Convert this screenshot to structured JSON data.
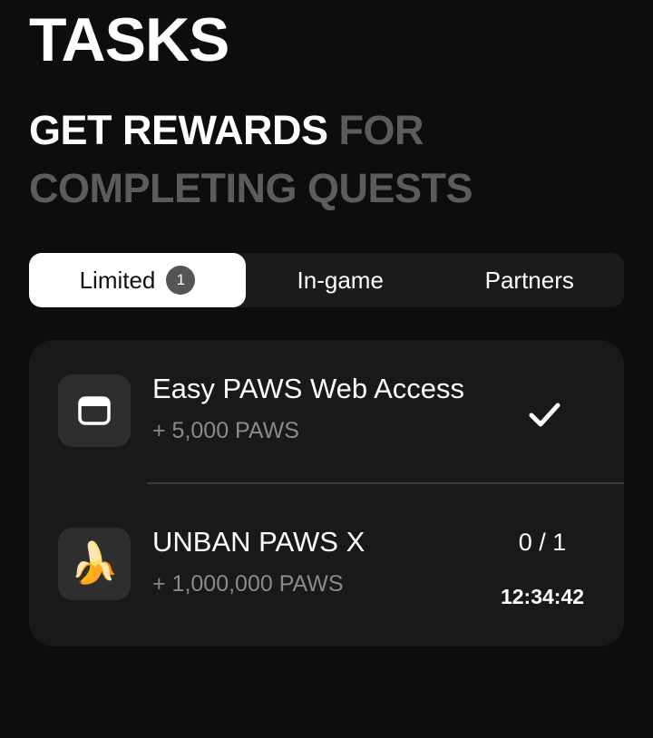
{
  "header": {
    "title": "TASKS",
    "subtitle_highlight": "GET REWARDS",
    "subtitle_rest": "FOR COMPLETING QUESTS"
  },
  "tabs": [
    {
      "label": "Limited",
      "badge": "1",
      "active": true
    },
    {
      "label": "In-game",
      "active": false
    },
    {
      "label": "Partners",
      "active": false
    }
  ],
  "tasks": [
    {
      "title": "Easy PAWS Web Access",
      "reward": "+ 5,000 PAWS",
      "icon": "browser-window-icon",
      "status": "completed",
      "status_icon": "checkmark-icon"
    },
    {
      "title": "UNBAN PAWS X",
      "reward": "+ 1,000,000 PAWS",
      "icon": "banana-icon",
      "progress": "0 / 1",
      "timer": "12:34:42"
    }
  ],
  "colors": {
    "background": "#0d0d0d",
    "card": "#191919",
    "muted_text": "#5c5c5c",
    "active_tab": "#ffffff"
  }
}
